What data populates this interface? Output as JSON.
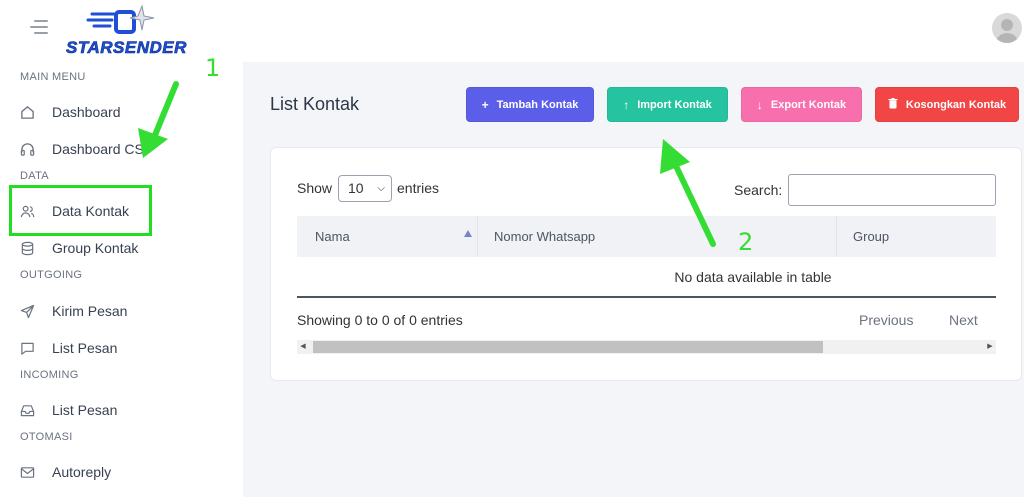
{
  "app": {
    "brand": "STARSENDER"
  },
  "sidebar": {
    "sections": [
      {
        "label": "MAIN MENU"
      },
      {
        "label": "DATA"
      },
      {
        "label": "OUTGOING"
      },
      {
        "label": "INCOMING"
      },
      {
        "label": "OTOMASI"
      }
    ],
    "items": [
      {
        "label": "Dashboard",
        "icon": "home-icon"
      },
      {
        "label": "Dashboard CS",
        "icon": "headset-icon"
      },
      {
        "label": "Data Kontak",
        "icon": "users-icon"
      },
      {
        "label": "Group Kontak",
        "icon": "database-icon"
      },
      {
        "label": "Kirim Pesan",
        "icon": "send-icon"
      },
      {
        "label": "List Pesan",
        "icon": "message-icon"
      },
      {
        "label": "List Pesan",
        "icon": "inbox-icon"
      },
      {
        "label": "Autoreply",
        "icon": "mail-icon"
      }
    ]
  },
  "main": {
    "title": "List Kontak",
    "buttons": {
      "tambah": "Tambah Kontak",
      "import": "Import Kontak",
      "export": "Export Kontak",
      "kosongkan": "Kosongkan Kontak"
    },
    "table": {
      "show_label": "Show",
      "page_length": "10",
      "entries_label": "entries",
      "search_label": "Search:",
      "search_value": "",
      "columns": [
        "Nama",
        "Nomor Whatsapp",
        "Group"
      ],
      "empty_message": "No data available in table",
      "info": "Showing 0 to 0 of 0 entries",
      "previous": "Previous",
      "next": "Next"
    }
  },
  "annotations": {
    "step1": "1",
    "step2": "2"
  },
  "colors": {
    "tambah": "#5b5ee9",
    "import": "#26c3a0",
    "export": "#f86fad",
    "kosongkan": "#f24545",
    "annotation": "#33dd33"
  }
}
